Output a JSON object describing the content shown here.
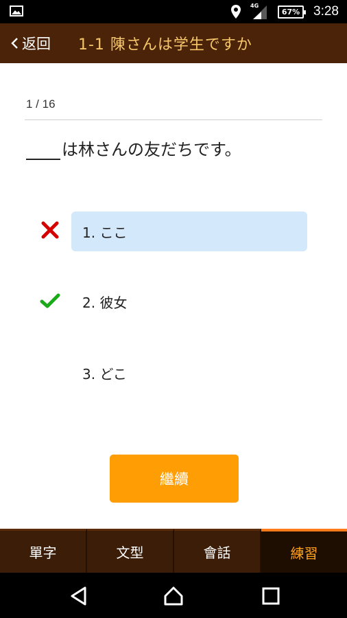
{
  "status_bar": {
    "time": "3:28",
    "battery": "67%",
    "network": "4G",
    "icons": [
      "image-icon",
      "location-icon",
      "signal-icon",
      "battery-icon"
    ]
  },
  "header": {
    "back_label": "返回",
    "title": "1-1 陳さんは学生ですか"
  },
  "quiz": {
    "progress": "1 / 16",
    "question_rest": "は林さんの友だちです。",
    "choices": [
      {
        "label": "1. ここ",
        "state": "wrong-selected",
        "mark": "cross-icon"
      },
      {
        "label": "2. 彼女",
        "state": "correct",
        "mark": "check-icon"
      },
      {
        "label": "3. どこ",
        "state": "none",
        "mark": ""
      }
    ],
    "continue_label": "繼續"
  },
  "tabs": [
    {
      "label": "單字",
      "active": false
    },
    {
      "label": "文型",
      "active": false
    },
    {
      "label": "會話",
      "active": false
    },
    {
      "label": "練習",
      "active": true
    }
  ],
  "colors": {
    "header_bg": "#4a2308",
    "title_color": "#f6c66a",
    "accent_orange": "#ff9d05",
    "selected_choice_bg": "#d4e8fb",
    "wrong_mark": "#d50000",
    "correct_mark": "#1aaa1a",
    "active_tab_text": "#ffa21b"
  },
  "nav": [
    "back-icon",
    "home-icon",
    "recents-icon"
  ]
}
